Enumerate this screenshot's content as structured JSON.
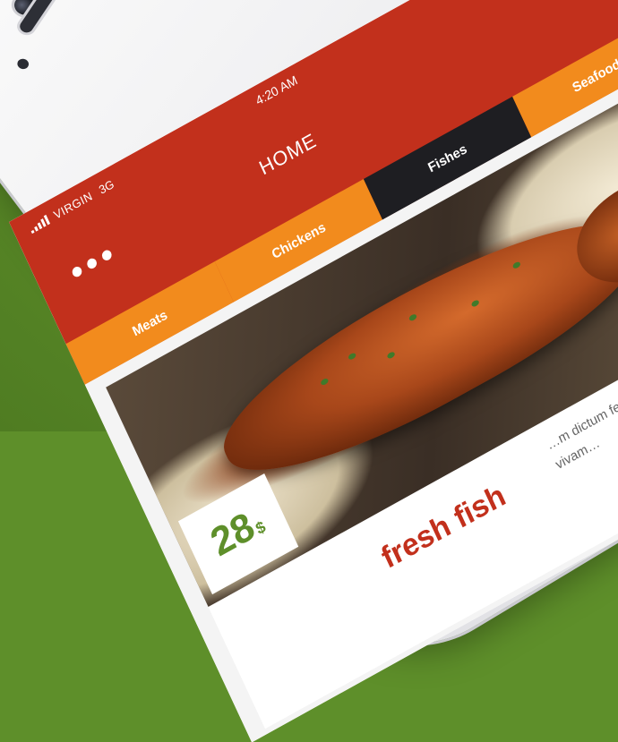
{
  "status_bar": {
    "carrier": "VIRGIN",
    "network": "3G",
    "time": "4:20 AM"
  },
  "header": {
    "title": "HOME",
    "menu_icon": "more-dots-icon",
    "back_icon": "back-arrow-icon"
  },
  "tabs": [
    {
      "label": "Meats",
      "active": false
    },
    {
      "label": "Chickens",
      "active": false
    },
    {
      "label": "Fishes",
      "active": true
    },
    {
      "label": "Seafood",
      "active": false
    }
  ],
  "food_card": {
    "price_value": "28",
    "price_currency": "$",
    "rating_stars": "★★★",
    "title": "fresh fish",
    "description": "…m dictum felis eu pede … dapibus. vivam…"
  },
  "colors": {
    "header_red": "#c2301c",
    "tab_orange": "#f28b1d",
    "tab_active": "#1e1e22",
    "price_green": "#5e8f2a",
    "background_green": "#5e8f2a"
  }
}
